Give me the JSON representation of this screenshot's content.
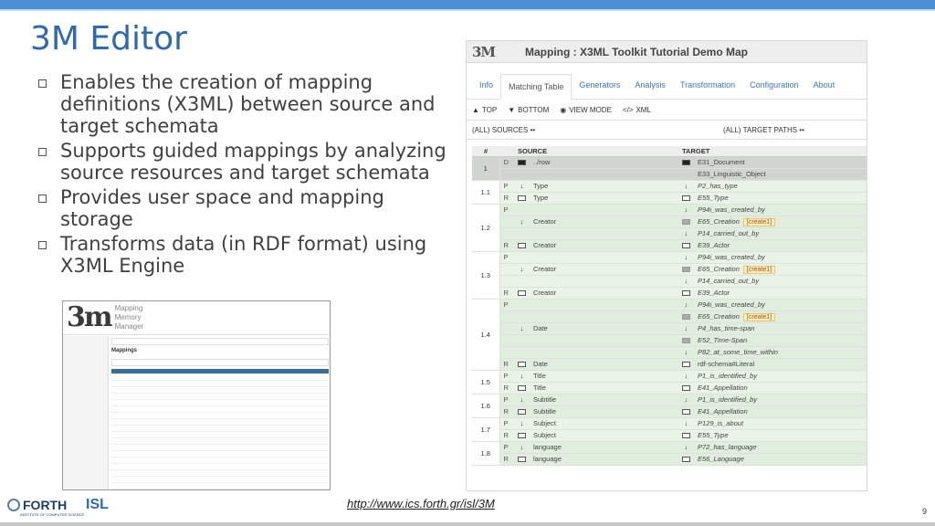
{
  "slide": {
    "title": "3M Editor",
    "bullets": [
      "Enables the creation of mapping definitions (X3ML) between source and target schemata",
      "Supports guided mappings by analyzing source resources and target schemata",
      "Provides user space and mapping storage",
      "Transforms data (in RDF format) using X3ML Engine"
    ],
    "footer_url": "http://www.ics.forth.gr/isl/3M",
    "page_number": "9",
    "logos": {
      "forth": "FORTH",
      "forth_sub": "INSTITUTE OF COMPUTER SCIENCE",
      "isl": "ISL"
    }
  },
  "editor": {
    "logo": "3M",
    "title": "Mapping : X3ML Toolkit Tutorial Demo Map",
    "tabs": [
      "Info",
      "Matching Table",
      "Generators",
      "Analysis",
      "Transformation",
      "Configuration",
      "About"
    ],
    "active_tab": "Matching Table",
    "toolbar": {
      "top": "TOP",
      "bottom": "BOTTOM",
      "view_mode": "VIEW MODE",
      "xml": "XML"
    },
    "filter": {
      "sources": "(ALL) SOURCES",
      "targets": "(ALL) TARGET PATHS"
    },
    "columns": {
      "num": "#",
      "source": "SOURCE",
      "target": "TARGET"
    },
    "rows": [
      {
        "group": "1",
        "kind": "D",
        "source": "../row",
        "target": "E31_Document",
        "src_icon": "filled",
        "tgt_icon": "filled",
        "dark": true
      },
      {
        "group": "",
        "kind": "",
        "source": "",
        "target": "E33_Linguistic_Object",
        "src_icon": "",
        "tgt_icon": "",
        "dark": true
      },
      {
        "group": "1.1",
        "kind": "P",
        "source": "Type",
        "target": "P2_has_type",
        "src_icon": "arrow",
        "tgt_icon": "arrow"
      },
      {
        "group": "",
        "kind": "R",
        "source": "Type",
        "target": "E55_Type",
        "src_icon": "box",
        "tgt_icon": "box"
      },
      {
        "group": "1.2",
        "kind": "P",
        "source": "",
        "target": "P94i_was_created_by",
        "src_icon": "",
        "tgt_icon": "arrow"
      },
      {
        "group": "",
        "kind": "",
        "source": "Creator",
        "target": "E65_Creation",
        "src_icon": "arrow",
        "tgt_icon": "grey",
        "badge": "[create1]"
      },
      {
        "group": "",
        "kind": "",
        "source": "",
        "target": "P14_carried_out_by",
        "src_icon": "",
        "tgt_icon": "arrow"
      },
      {
        "group": "",
        "kind": "R",
        "source": "Creator",
        "target": "E39_Actor",
        "src_icon": "box",
        "tgt_icon": "box"
      },
      {
        "group": "1.3",
        "kind": "P",
        "source": "",
        "target": "P94i_was_created_by",
        "src_icon": "",
        "tgt_icon": "arrow"
      },
      {
        "group": "",
        "kind": "",
        "source": "Creator",
        "target": "E65_Creation",
        "src_icon": "arrow",
        "tgt_icon": "grey",
        "badge": "[create1]"
      },
      {
        "group": "",
        "kind": "",
        "source": "",
        "target": "P14_carried_out_by",
        "src_icon": "",
        "tgt_icon": "arrow"
      },
      {
        "group": "",
        "kind": "R",
        "source": "Creator",
        "target": "E39_Actor",
        "src_icon": "box",
        "tgt_icon": "box"
      },
      {
        "group": "1.4",
        "kind": "P",
        "source": "",
        "target": "P94i_was_created_by",
        "src_icon": "",
        "tgt_icon": "arrow"
      },
      {
        "group": "",
        "kind": "",
        "source": "",
        "target": "E65_Creation",
        "src_icon": "",
        "tgt_icon": "grey",
        "badge": "[create1]"
      },
      {
        "group": "",
        "kind": "",
        "source": "Date",
        "target": "P4_has_time-span",
        "src_icon": "arrow",
        "tgt_icon": "arrow"
      },
      {
        "group": "",
        "kind": "",
        "source": "",
        "target": "E52_Time-Span",
        "src_icon": "",
        "tgt_icon": "grey"
      },
      {
        "group": "",
        "kind": "",
        "source": "",
        "target": "P82_at_some_time_within",
        "src_icon": "",
        "tgt_icon": "arrow"
      },
      {
        "group": "",
        "kind": "R",
        "source": "Date",
        "target": "rdf-schema#Literal",
        "src_icon": "box",
        "tgt_icon": "box",
        "plain": true
      },
      {
        "group": "1.5",
        "kind": "P",
        "source": "Title",
        "target": "P1_is_identified_by",
        "src_icon": "arrow",
        "tgt_icon": "arrow"
      },
      {
        "group": "",
        "kind": "R",
        "source": "Title",
        "target": "E41_Appellation",
        "src_icon": "box",
        "tgt_icon": "box"
      },
      {
        "group": "1.6",
        "kind": "P",
        "source": "Subtitle",
        "target": "P1_is_identified_by",
        "src_icon": "arrow",
        "tgt_icon": "arrow"
      },
      {
        "group": "",
        "kind": "R",
        "source": "Subtitle",
        "target": "E41_Appellation",
        "src_icon": "box",
        "tgt_icon": "box"
      },
      {
        "group": "1.7",
        "kind": "P",
        "source": "Subject",
        "target": "P129_is_about",
        "src_icon": "arrow",
        "tgt_icon": "arrow"
      },
      {
        "group": "",
        "kind": "R",
        "source": "Subject",
        "target": "E55_Type",
        "src_icon": "box",
        "tgt_icon": "box"
      },
      {
        "group": "1.8",
        "kind": "P",
        "source": "language",
        "target": "P72_has_language",
        "src_icon": "arrow",
        "tgt_icon": "arrow"
      },
      {
        "group": "",
        "kind": "R",
        "source": "language",
        "target": "E56_Language",
        "src_icon": "box",
        "tgt_icon": "box"
      }
    ]
  },
  "mm": {
    "logo": "3m",
    "lines": [
      "Mapping",
      "Memory",
      "Manager"
    ],
    "title": "Mappings"
  }
}
